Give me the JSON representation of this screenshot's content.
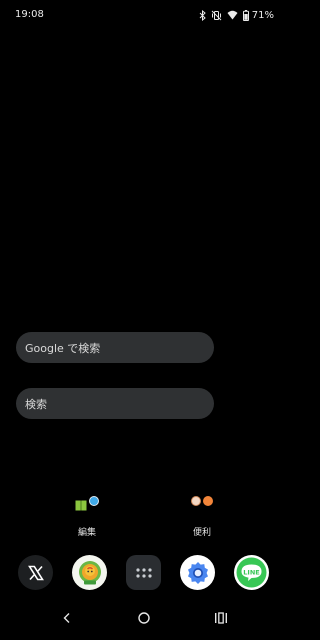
{
  "status_bar": {
    "time": "19:08",
    "battery_percent": "71%",
    "icons": [
      "bluetooth-icon",
      "vibrate-icon",
      "wifi-icon",
      "battery-icon"
    ]
  },
  "search_bars": [
    {
      "placeholder": "Google で検索"
    },
    {
      "placeholder": "検索"
    }
  ],
  "folders": [
    {
      "label": "編集",
      "icons": [
        "green-book-icon",
        "blue-dot-icon"
      ]
    },
    {
      "label": "便利",
      "icons": [
        "face-icon",
        "orange-dot-icon"
      ]
    }
  ],
  "dock": {
    "apps": [
      "x-icon",
      "fruit-app-icon",
      "app-drawer-icon",
      "settings-icon",
      "line-icon"
    ],
    "line_label": "LINE"
  },
  "nav_bar": {
    "buttons": [
      "back-icon",
      "home-icon",
      "recents-icon"
    ]
  },
  "colors": {
    "background": "#000000",
    "search_bar": "#2f3133",
    "line_green": "#38c755",
    "settings_blue": "#4a86f0"
  }
}
